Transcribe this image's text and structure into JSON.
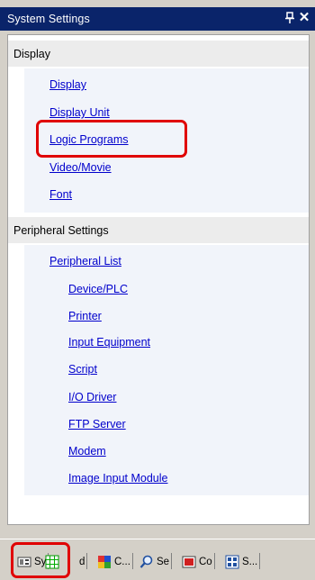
{
  "window": {
    "title": "System Settings",
    "pin_icon": "pin-icon",
    "close_icon": "close-icon",
    "pin_glyph": "ᴖ",
    "close_glyph": "✕"
  },
  "sections": {
    "display": {
      "header": "Display",
      "items": [
        "Display",
        "Display Unit",
        "Logic Programs",
        "Video/Movie",
        "Font"
      ]
    },
    "peripheral": {
      "header": "Peripheral Settings",
      "list_label": "Peripheral List",
      "items": [
        "Device/PLC",
        "Printer",
        "Input Equipment",
        "Script",
        "I/O Driver",
        "FTP Server",
        "Modem",
        "Image Input Module"
      ]
    }
  },
  "tabs": [
    {
      "label": "Sy",
      "icon": "system-settings-icon"
    },
    {
      "label": "",
      "icon": "grid-icon"
    },
    {
      "label": "d",
      "icon": ""
    },
    {
      "label": "C...",
      "icon": "color-palette-icon"
    },
    {
      "label": "Se",
      "icon": "search-icon"
    },
    {
      "label": "Co",
      "icon": "common-settings-icon"
    },
    {
      "label": "S...",
      "icon": "screen-list-icon"
    }
  ],
  "colors": {
    "titlebar": "#0a246a",
    "link": "#0000cc",
    "highlight": "#e00000"
  }
}
